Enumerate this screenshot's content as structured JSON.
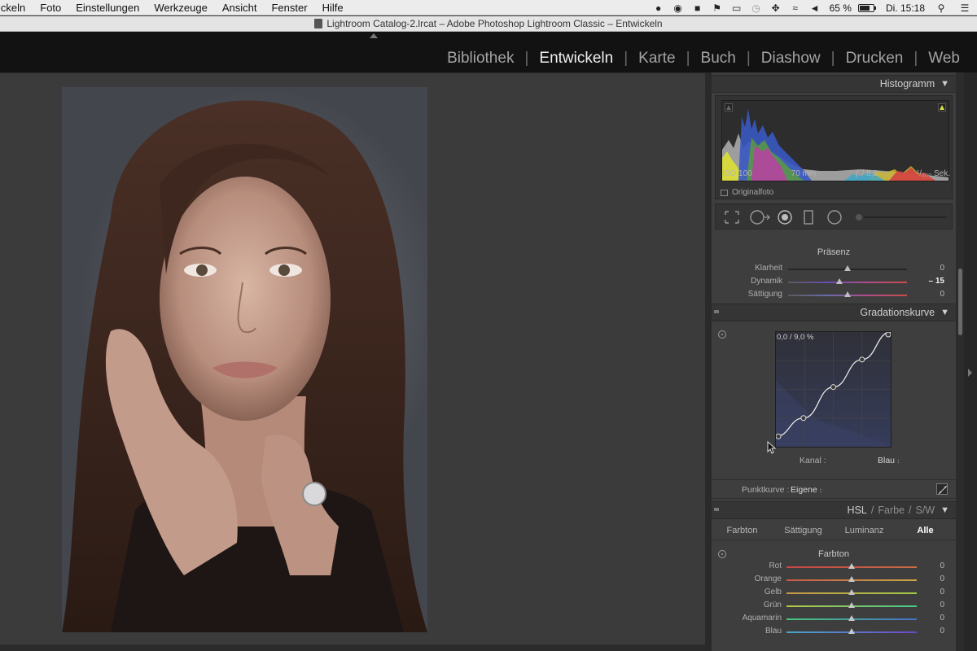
{
  "menubar": {
    "items": [
      "ickeln",
      "Foto",
      "Einstellungen",
      "Werkzeuge",
      "Ansicht",
      "Fenster",
      "Hilfe"
    ],
    "battery_text": "65 %",
    "battery_level": 0.65,
    "clock": "Di. 15:18"
  },
  "window": {
    "title": "Lightroom Catalog-2.lrcat – Adobe Photoshop Lightroom Classic – Entwickeln"
  },
  "modules": {
    "items": [
      "Bibliothek",
      "Entwickeln",
      "Karte",
      "Buch",
      "Diashow",
      "Drucken",
      "Web"
    ],
    "active_index": 1
  },
  "histogram": {
    "title": "Histogramm",
    "iso": "ISO 100",
    "focal": "70 mm",
    "aperture": "ƒ / 8,0",
    "shutter": "¹/₂₀₀ Sek.",
    "original_label": "Originalfoto"
  },
  "presence": {
    "title": "Präsenz",
    "sliders": [
      {
        "label": "Klarheit",
        "value": "0",
        "level": 0.5
      },
      {
        "label": "Dynamik",
        "value": "– 15",
        "level": 0.43,
        "highlight": true
      },
      {
        "label": "Sättigung",
        "value": "0",
        "level": 0.5
      }
    ]
  },
  "tone_curve": {
    "title": "Gradationskurve",
    "readout": "0,0 / 9,0 %",
    "channel_label": "Kanal :",
    "channel_value": "Blau",
    "pointcurve_label": "Punktkurve :",
    "pointcurve_value": "Eigene",
    "points": [
      [
        0,
        9
      ],
      [
        24,
        25
      ],
      [
        50,
        52
      ],
      [
        75,
        76
      ],
      [
        100,
        100
      ]
    ]
  },
  "hsl": {
    "header_hsl": "HSL",
    "header_farbe": "Farbe",
    "header_sw": "S/W",
    "sep": "/",
    "tabs": [
      "Farbton",
      "Sättigung",
      "Luminanz",
      "Alle"
    ],
    "active_tab": 3,
    "section_title": "Farbton",
    "sliders": [
      {
        "label": "Rot",
        "value": "0",
        "level": 0.5,
        "colors": [
          "#c84646",
          "#c86c46"
        ]
      },
      {
        "label": "Orange",
        "value": "0",
        "level": 0.5,
        "colors": [
          "#c85a46",
          "#c8a846"
        ]
      },
      {
        "label": "Gelb",
        "value": "0",
        "level": 0.5,
        "colors": [
          "#c89646",
          "#a0c846"
        ]
      },
      {
        "label": "Grün",
        "value": "0",
        "level": 0.5,
        "colors": [
          "#b4c846",
          "#46c88c"
        ]
      },
      {
        "label": "Aquamarin",
        "value": "0",
        "level": 0.5,
        "colors": [
          "#46c878",
          "#4670c8"
        ]
      },
      {
        "label": "Blau",
        "value": "0",
        "level": 0.5,
        "colors": [
          "#46a8c8",
          "#7046c8"
        ]
      }
    ]
  }
}
